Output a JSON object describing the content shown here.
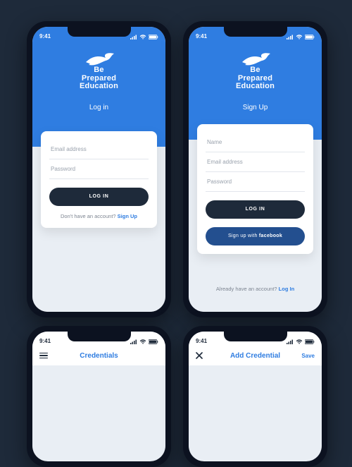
{
  "status": {
    "time": "9:41",
    "signal_icon": "signal",
    "wifi_icon": "wifi",
    "battery_icon": "battery"
  },
  "brand": {
    "line1": "Be",
    "line2": "Prepared",
    "line3": "Education"
  },
  "login": {
    "title": "Log in",
    "email_ph": "Email address",
    "password_ph": "Password",
    "submit": "LOG IN",
    "alt_text": "Don't have an account? ",
    "alt_link": "Sign Up"
  },
  "signup": {
    "title": "Sign Up",
    "name_ph": "Name",
    "email_ph": "Email address",
    "password_ph": "Password",
    "submit": "LOG IN",
    "fb_prefix": "Sign up with ",
    "fb_bold": "facebook",
    "alt_text": "Already have an account? ",
    "alt_link": "Log In"
  },
  "bottom_left": {
    "title": "Credentials"
  },
  "bottom_right": {
    "title": "Add Credential",
    "save": "Save"
  }
}
